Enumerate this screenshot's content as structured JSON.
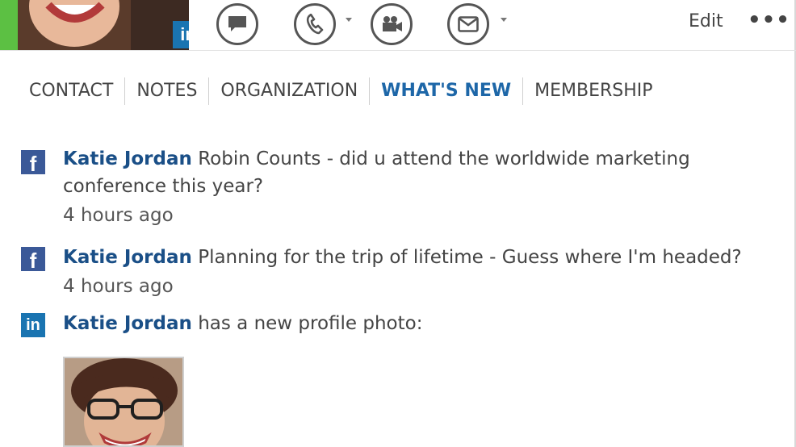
{
  "header": {
    "presence_color": "#5cc043",
    "avatar_badge": "in",
    "actions": [
      {
        "name": "im-button",
        "icon": "chat-bubble-icon",
        "has_dropdown": false
      },
      {
        "name": "call-button",
        "icon": "phone-icon",
        "has_dropdown": true
      },
      {
        "name": "video-button",
        "icon": "video-camera-icon",
        "has_dropdown": false
      },
      {
        "name": "email-button",
        "icon": "mail-icon",
        "has_dropdown": true
      }
    ],
    "edit_label": "Edit",
    "more_label": "•••"
  },
  "tabs": [
    {
      "label": "CONTACT",
      "active": false
    },
    {
      "label": "NOTES",
      "active": false
    },
    {
      "label": "ORGANIZATION",
      "active": false
    },
    {
      "label": "WHAT'S NEW",
      "active": true
    },
    {
      "label": "MEMBERSHIP",
      "active": false
    }
  ],
  "feed": {
    "items": [
      {
        "source": "facebook",
        "source_glyph": "f",
        "author": "Katie Jordan",
        "text": "Robin Counts - did u attend the worldwide marketing conference this year?",
        "time": "4 hours ago"
      },
      {
        "source": "facebook",
        "source_glyph": "f",
        "author": "Katie Jordan",
        "text": "Planning for the trip of lifetime - Guess where I'm headed?",
        "time": "4 hours ago"
      },
      {
        "source": "linkedin",
        "source_glyph": "in",
        "author": "Katie Jordan",
        "text": "has a new profile photo:",
        "time": ""
      }
    ]
  },
  "colors": {
    "accent": "#1e67a8",
    "author": "#1a4f87",
    "facebook": "#3b5998",
    "linkedin": "#1a74b1"
  }
}
